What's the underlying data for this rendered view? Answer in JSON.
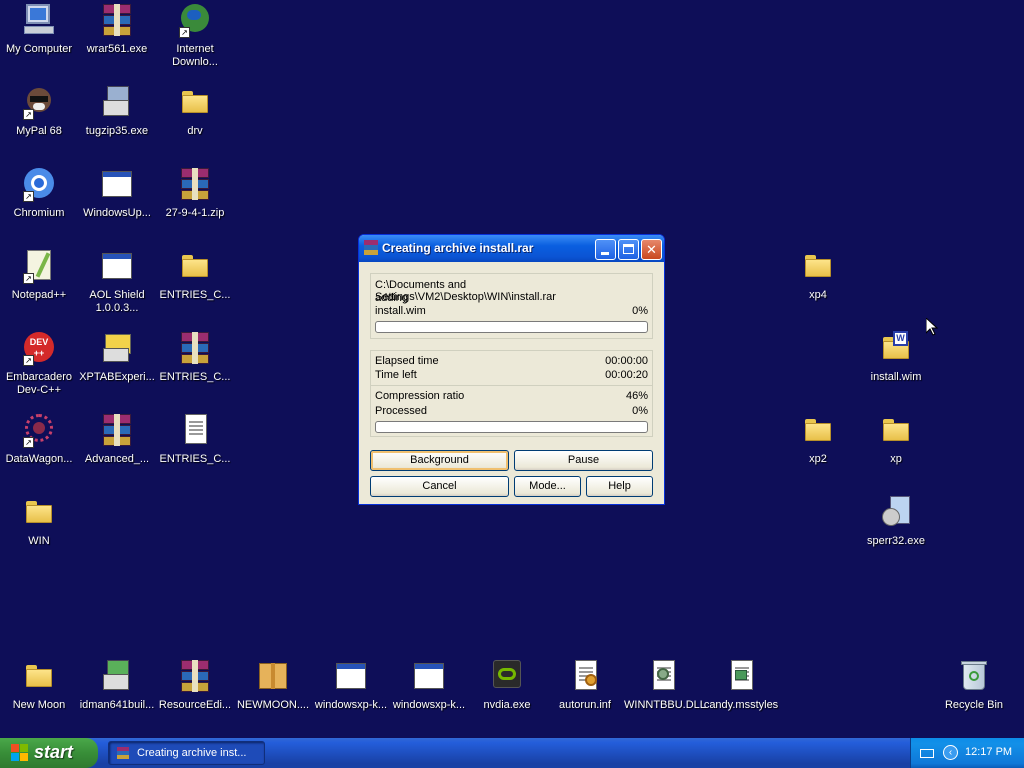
{
  "desktop_icons": {
    "my_computer": "My Computer",
    "wrar": "wrar561.exe",
    "idm": "Internet\nDownlo...",
    "mypal": "MyPal 68",
    "tugzip": "tugzip35.exe",
    "drv": "drv",
    "chromium": "Chromium",
    "windowsup": "WindowsUp...",
    "zip": "27-9-4-1.zip",
    "notepad": "Notepad++",
    "aol": "AOL Shield\n1.0.0.3...",
    "entries1": "ENTRIES_C...",
    "dev": "Embarcadero\nDev-C++",
    "xptab": "XPTABExperi...",
    "entries2": "ENTRIES_C...",
    "datawagon": "DataWagon...",
    "advanced": "Advanced_...",
    "entries3": "ENTRIES_C...",
    "win": "WIN",
    "xp4": "xp4",
    "install_wim": "install.wim",
    "xp2": "xp2",
    "xp": "xp",
    "sperr": "sperr32.exe",
    "newmoon": "New Moon",
    "idman": "idman641buil...",
    "resedit": "ResourceEdi...",
    "newmoon2": "NEWMOON....",
    "wxk1": "windowsxp-k...",
    "wxk2": "windowsxp-k...",
    "nvidia": "nvdia.exe",
    "autorun": "autorun.inf",
    "winntbbu": "WINNTBBU.DLL",
    "candy": "candy.msstyles",
    "recycle": "Recycle Bin"
  },
  "dialog": {
    "title": "Creating archive install.rar",
    "archive_path": "C:\\Documents and Settings\\VM2\\Desktop\\WIN\\install.rar",
    "action": "adding",
    "file_name": "install.wim",
    "file_percent": "0%",
    "file_progress": 0,
    "elapsed_label": "Elapsed time",
    "elapsed_value": "00:00:00",
    "time_left_label": "Time left",
    "time_left_value": "00:00:20",
    "ratio_label": "Compression ratio",
    "ratio_value": "46%",
    "processed_label": "Processed",
    "processed_value": "0%",
    "processed_progress": 0,
    "buttons": {
      "background": "Background",
      "pause": "Pause",
      "cancel": "Cancel",
      "mode": "Mode...",
      "help": "Help"
    }
  },
  "taskbar": {
    "start_label": "start",
    "task_label": "Creating archive inst...",
    "clock": "12:17 PM"
  },
  "colors": {
    "desktop": "#0e0e58",
    "dialog_face": "#ece9d8",
    "titlebar": "#0b54d4"
  }
}
